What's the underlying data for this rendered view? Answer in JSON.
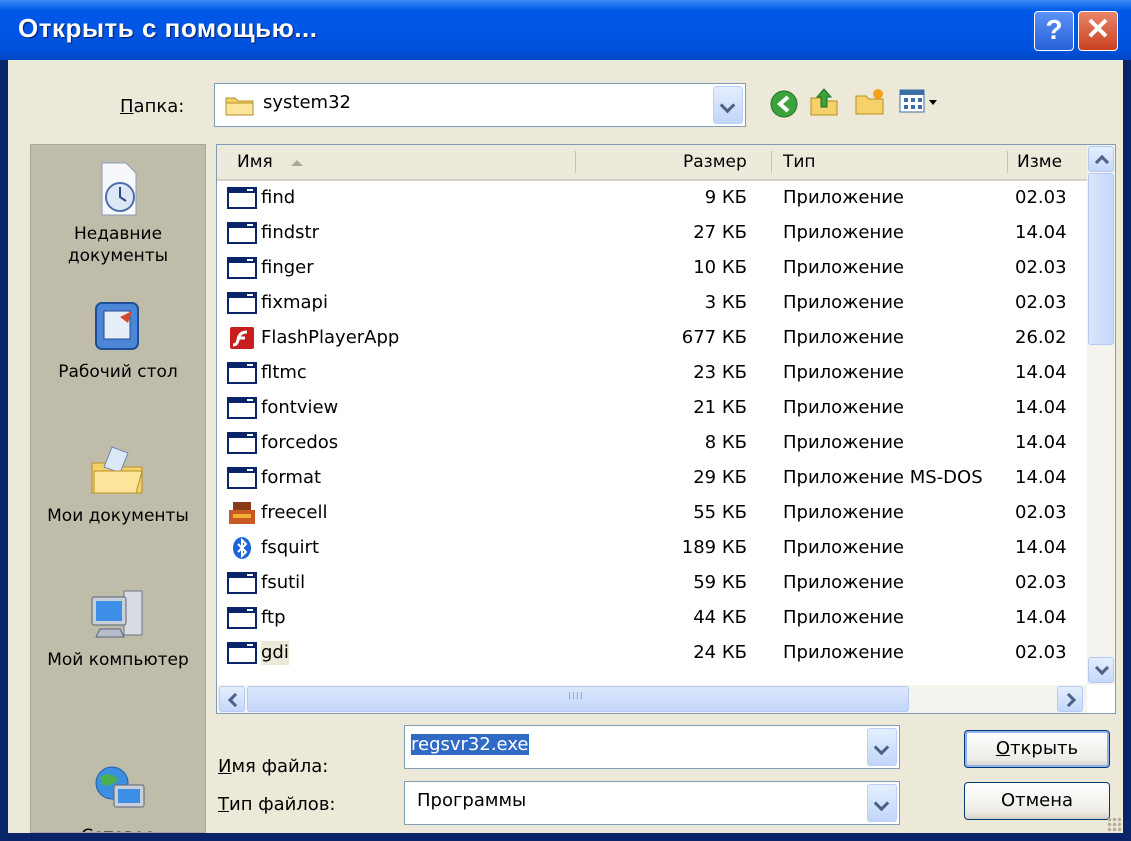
{
  "window": {
    "title": "Открыть с помощью...",
    "help_label": "?",
    "close_label": "✕"
  },
  "lookin": {
    "label_underlined": "П",
    "label_rest": "апка:",
    "value": "system32",
    "icon": "folder-icon"
  },
  "toolbar": {
    "back_icon": "back-arrow-icon",
    "up_icon": "up-folder-icon",
    "new_folder_icon": "new-folder-icon",
    "views_icon": "views-menu-icon"
  },
  "places": [
    {
      "label": "Недавние документы",
      "icon": "recent-documents-icon"
    },
    {
      "label": "Рабочий стол",
      "icon": "desktop-icon"
    },
    {
      "label": "Мои документы",
      "icon": "my-documents-icon"
    },
    {
      "label": "Мой компьютер",
      "icon": "my-computer-icon"
    },
    {
      "label": "Сетевое",
      "icon": "network-icon"
    }
  ],
  "columns": {
    "name": "Имя",
    "size": "Размер",
    "type": "Тип",
    "date": "Изме"
  },
  "files": [
    {
      "name": "find",
      "size": "9 КБ",
      "type": "Приложение",
      "date": "02.03",
      "icon": "app-window-icon"
    },
    {
      "name": "findstr",
      "size": "27 КБ",
      "type": "Приложение",
      "date": "14.04",
      "icon": "app-window-icon"
    },
    {
      "name": "finger",
      "size": "10 КБ",
      "type": "Приложение",
      "date": "02.03",
      "icon": "app-window-icon"
    },
    {
      "name": "fixmapi",
      "size": "3 КБ",
      "type": "Приложение",
      "date": "02.03",
      "icon": "app-window-icon"
    },
    {
      "name": "FlashPlayerApp",
      "size": "677 КБ",
      "type": "Приложение",
      "date": "26.02",
      "icon": "flash-icon"
    },
    {
      "name": "fltmc",
      "size": "23 КБ",
      "type": "Приложение",
      "date": "14.04",
      "icon": "app-window-icon"
    },
    {
      "name": "fontview",
      "size": "21 КБ",
      "type": "Приложение",
      "date": "14.04",
      "icon": "app-window-icon"
    },
    {
      "name": "forcedos",
      "size": "8 КБ",
      "type": "Приложение",
      "date": "14.04",
      "icon": "app-window-icon"
    },
    {
      "name": "format",
      "size": "29 КБ",
      "type": "Приложение MS-DOS",
      "date": "14.04",
      "icon": "app-window-icon"
    },
    {
      "name": "freecell",
      "size": "55 КБ",
      "type": "Приложение",
      "date": "02.03",
      "icon": "freecell-icon"
    },
    {
      "name": "fsquirt",
      "size": "189 КБ",
      "type": "Приложение",
      "date": "14.04",
      "icon": "bluetooth-icon"
    },
    {
      "name": "fsutil",
      "size": "59 КБ",
      "type": "Приложение",
      "date": "02.03",
      "icon": "app-window-icon"
    },
    {
      "name": "ftp",
      "size": "44 КБ",
      "type": "Приложение",
      "date": "14.04",
      "icon": "app-window-icon"
    },
    {
      "name": "gdi",
      "size": "24 КБ",
      "type": "Приложение",
      "date": "02.03",
      "icon": "app-window-icon"
    }
  ],
  "filename": {
    "label_underlined": "И",
    "label_rest": "мя файла:",
    "value": "regsvr32.exe"
  },
  "filetype": {
    "label_underlined": "Т",
    "label_rest": "ип файлов:",
    "value": "Программы"
  },
  "buttons": {
    "open_underlined": "О",
    "open_rest": "ткрыть",
    "cancel": "Отмена"
  },
  "scroll": {
    "h_grip": "IIII"
  }
}
